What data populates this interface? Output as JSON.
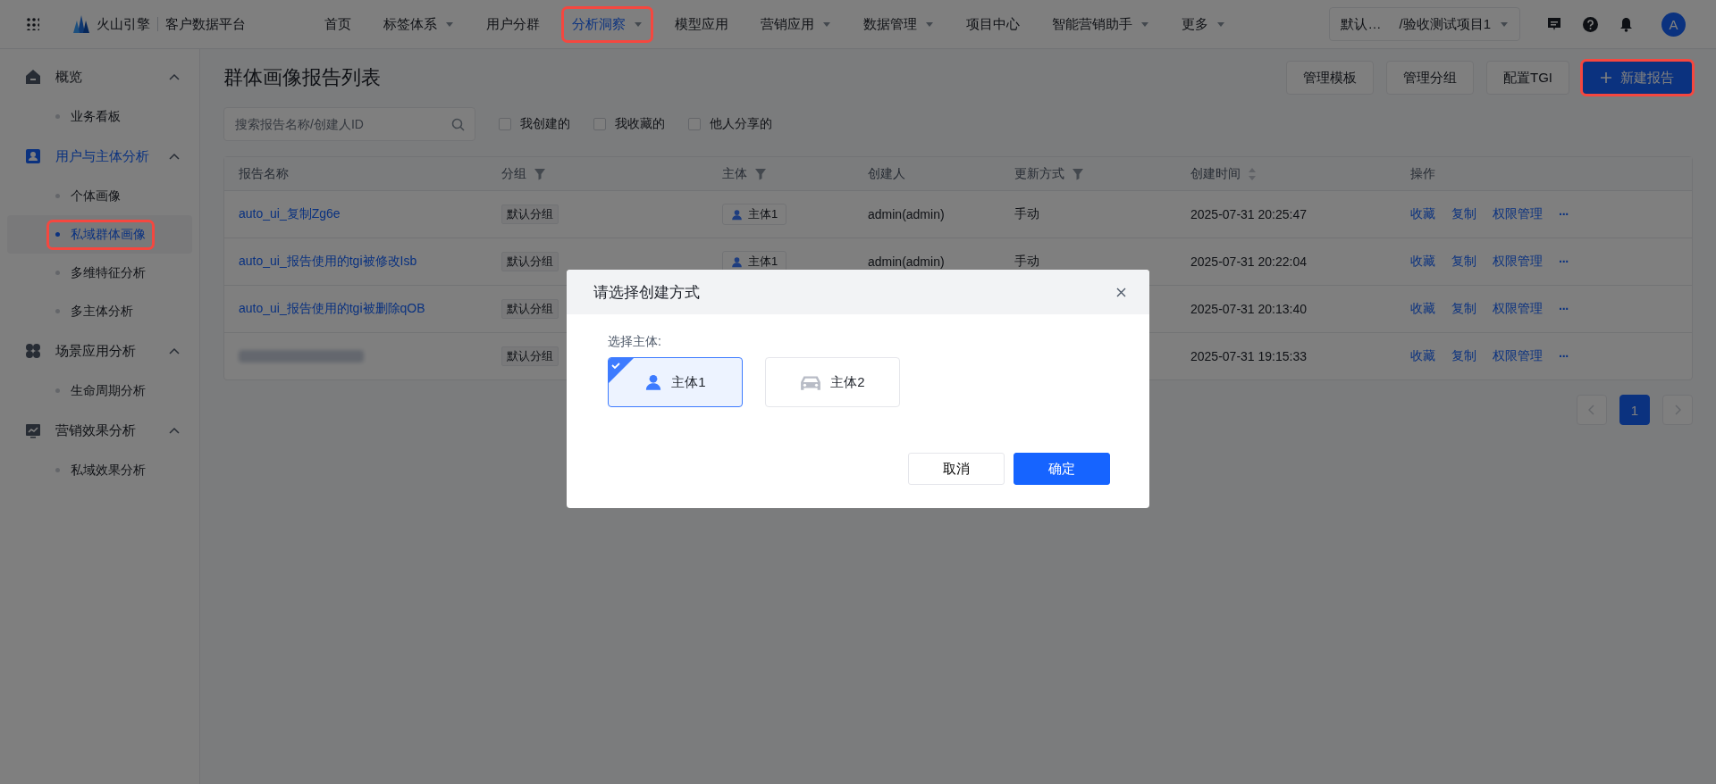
{
  "topbar": {
    "brand": "火山引擎",
    "product": "客户数据平台",
    "nav": [
      {
        "label": "首页",
        "dropdown": false,
        "selected": false,
        "highlighted": false
      },
      {
        "label": "标签体系",
        "dropdown": true,
        "selected": false,
        "highlighted": false
      },
      {
        "label": "用户分群",
        "dropdown": false,
        "selected": false,
        "highlighted": false
      },
      {
        "label": "分析洞察",
        "dropdown": true,
        "selected": true,
        "highlighted": true
      },
      {
        "label": "模型应用",
        "dropdown": false,
        "selected": false,
        "highlighted": false
      },
      {
        "label": "营销应用",
        "dropdown": true,
        "selected": false,
        "highlighted": false
      },
      {
        "label": "数据管理",
        "dropdown": true,
        "selected": false,
        "highlighted": false
      },
      {
        "label": "项目中心",
        "dropdown": false,
        "selected": false,
        "highlighted": false
      },
      {
        "label": "智能营销助手",
        "dropdown": true,
        "selected": false,
        "highlighted": false
      },
      {
        "label": "更多",
        "dropdown": true,
        "selected": false,
        "highlighted": false
      }
    ],
    "project": {
      "workspace": "默认…",
      "name": "/验收测试项目1"
    },
    "avatar": "A"
  },
  "sidebar": {
    "groups": [
      {
        "label": "概览",
        "expanded": true,
        "selected": false,
        "children": [
          {
            "label": "业务看板",
            "selected": false,
            "highlighted": false
          }
        ]
      },
      {
        "label": "用户与主体分析",
        "expanded": true,
        "selected": true,
        "children": [
          {
            "label": "个体画像",
            "selected": false,
            "highlighted": false
          },
          {
            "label": "私域群体画像",
            "selected": true,
            "highlighted": true
          },
          {
            "label": "多维特征分析",
            "selected": false,
            "highlighted": false
          },
          {
            "label": "多主体分析",
            "selected": false,
            "highlighted": false
          }
        ]
      },
      {
        "label": "场景应用分析",
        "expanded": true,
        "selected": false,
        "children": [
          {
            "label": "生命周期分析",
            "selected": false,
            "highlighted": false
          }
        ]
      },
      {
        "label": "营销效果分析",
        "expanded": true,
        "selected": false,
        "children": [
          {
            "label": "私域效果分析",
            "selected": false,
            "highlighted": false
          }
        ]
      }
    ]
  },
  "page": {
    "title": "群体画像报告列表",
    "buttons": [
      {
        "label": "管理模板",
        "kind": "default",
        "highlighted": false
      },
      {
        "label": "管理分组",
        "kind": "default",
        "highlighted": false
      },
      {
        "label": "配置TGI",
        "kind": "default",
        "highlighted": false
      },
      {
        "label": "新建报告",
        "kind": "primary",
        "highlighted": true
      }
    ],
    "search": {
      "placeholder": "搜索报告名称/创建人ID"
    },
    "filters": [
      {
        "label": "我创建的",
        "checked": false
      },
      {
        "label": "我收藏的",
        "checked": false
      },
      {
        "label": "他人分享的",
        "checked": false
      }
    ]
  },
  "table": {
    "columns": [
      {
        "label": "报告名称",
        "filter": false,
        "sort": false
      },
      {
        "label": "分组",
        "filter": true,
        "sort": false
      },
      {
        "label": "主体",
        "filter": true,
        "sort": false
      },
      {
        "label": "创建人",
        "filter": false,
        "sort": false
      },
      {
        "label": "更新方式",
        "filter": true,
        "sort": false
      },
      {
        "label": "创建时间",
        "filter": false,
        "sort": true
      },
      {
        "label": "操作",
        "filter": false,
        "sort": false
      }
    ],
    "rows": [
      {
        "name": "auto_ui_复制Zg6e",
        "blurred": false,
        "group": "默认分组",
        "subject": "主体1",
        "creator": "admin(admin)",
        "update": "手动",
        "created": "2025-07-31 20:25:47",
        "actions": [
          "收藏",
          "复制",
          "权限管理"
        ],
        "more": "···"
      },
      {
        "name": "auto_ui_报告使用的tgi被修改Isb",
        "blurred": false,
        "group": "默认分组",
        "subject": "主体1",
        "creator": "admin(admin)",
        "update": "手动",
        "created": "2025-07-31 20:22:04",
        "actions": [
          "收藏",
          "复制",
          "权限管理"
        ],
        "more": "···"
      },
      {
        "name": "auto_ui_报告使用的tgi被删除qOB",
        "blurred": false,
        "group": "默认分组",
        "created": "2025-07-31 20:13:40",
        "actions": [
          "收藏",
          "复制",
          "权限管理"
        ],
        "more": "···"
      },
      {
        "blurred": true,
        "group": "默认分组",
        "created": "2025-07-31 19:15:33",
        "actions": [
          "收藏",
          "复制",
          "权限管理"
        ],
        "more": "···"
      }
    ]
  },
  "pagination": {
    "pages": [
      {
        "label": "1",
        "selected": true
      }
    ]
  },
  "dialog": {
    "title": "请选择创建方式",
    "field_label": "选择主体:",
    "options": [
      {
        "label": "主体1",
        "kind": "person",
        "selected": true
      },
      {
        "label": "主体2",
        "kind": "car",
        "selected": false
      }
    ],
    "buttons": [
      {
        "label": "取消",
        "kind": "default"
      },
      {
        "label": "确定",
        "kind": "primary"
      }
    ]
  }
}
